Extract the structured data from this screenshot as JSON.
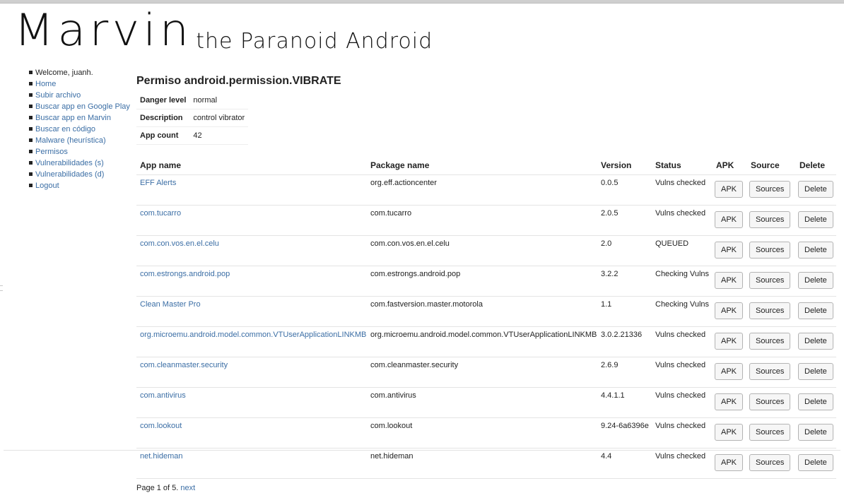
{
  "header": {
    "title": "Marvin",
    "subtitle": "the Paranoid Android"
  },
  "sidebar": {
    "welcome": "Welcome, juanh.",
    "items": [
      {
        "label": "Home"
      },
      {
        "label": "Subir archivo"
      },
      {
        "label": "Buscar app en Google Play"
      },
      {
        "label": "Buscar app en Marvin"
      },
      {
        "label": "Buscar en código"
      },
      {
        "label": "Malware (heurística)"
      },
      {
        "label": "Permisos"
      },
      {
        "label": "Vulnerabilidades (s)"
      },
      {
        "label": "Vulnerabilidades (d)"
      },
      {
        "label": "Logout"
      }
    ]
  },
  "main": {
    "title": "Permiso android.permission.VIBRATE",
    "info": {
      "danger_label": "Danger level",
      "danger_value": "normal",
      "description_label": "Description",
      "description_value": "control vibrator",
      "count_label": "App count",
      "count_value": "42"
    },
    "columns": {
      "app_name": "App name",
      "package_name": "Package name",
      "version": "Version",
      "status": "Status",
      "apk": "APK",
      "source": "Source",
      "delete": "Delete"
    },
    "buttons": {
      "apk": "APK",
      "sources": "Sources",
      "delete": "Delete"
    },
    "rows": [
      {
        "app": "EFF Alerts",
        "package": "org.eff.actioncenter",
        "version": "0.0.5",
        "status": "Vulns checked"
      },
      {
        "app": "com.tucarro",
        "package": "com.tucarro",
        "version": "2.0.5",
        "status": "Vulns checked"
      },
      {
        "app": "com.con.vos.en.el.celu",
        "package": "com.con.vos.en.el.celu",
        "version": "2.0",
        "status": "QUEUED"
      },
      {
        "app": "com.estrongs.android.pop",
        "package": "com.estrongs.android.pop",
        "version": "3.2.2",
        "status": "Checking Vulns"
      },
      {
        "app": "Clean Master Pro",
        "package": "com.fastversion.master.motorola",
        "version": "1.1",
        "status": "Checking Vulns"
      },
      {
        "app": "org.microemu.android.model.common.VTUserApplicationLINKMB",
        "package": "org.microemu.android.model.common.VTUserApplicationLINKMB",
        "version": "3.0.2.21336",
        "status": "Vulns checked"
      },
      {
        "app": "com.cleanmaster.security",
        "package": "com.cleanmaster.security",
        "version": "2.6.9",
        "status": "Vulns checked"
      },
      {
        "app": "com.antivirus",
        "package": "com.antivirus",
        "version": "4.4.1.1",
        "status": "Vulns checked"
      },
      {
        "app": "com.lookout",
        "package": "com.lookout",
        "version": "9.24-6a6396e",
        "status": "Vulns checked"
      },
      {
        "app": "net.hideman",
        "package": "net.hideman",
        "version": "4.4",
        "status": "Vulns checked"
      }
    ],
    "pagination": {
      "text": "Page 1 of 5.",
      "next": "next"
    }
  }
}
